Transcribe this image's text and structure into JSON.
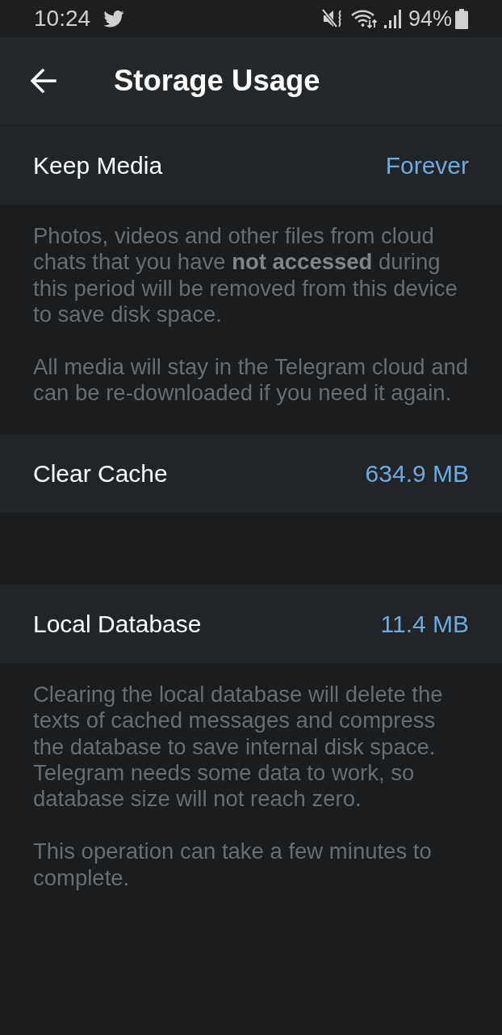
{
  "status_bar": {
    "time": "10:24",
    "battery": "94%"
  },
  "app_bar": {
    "title": "Storage Usage"
  },
  "groups": [
    {
      "rows": [
        {
          "label": "Keep Media",
          "value": "Forever"
        }
      ],
      "footer": [
        "Photos, videos and other files from cloud chats that you have **not accessed** during this period will be removed from this device to save disk space.",
        "All media will stay in the Telegram cloud and can be re-downloaded if you need it again."
      ]
    },
    {
      "rows": [
        {
          "label": "Clear Cache",
          "value": "634.9 MB"
        }
      ]
    },
    {
      "rows": [
        {
          "label": "Local Database",
          "value": "11.4 MB"
        }
      ],
      "footer": [
        "Clearing the local database will delete the texts of cached messages and compress the database to save internal disk space. Telegram needs some data to work, so database size will not reach zero.",
        "This operation can take a few minutes to complete."
      ]
    }
  ]
}
